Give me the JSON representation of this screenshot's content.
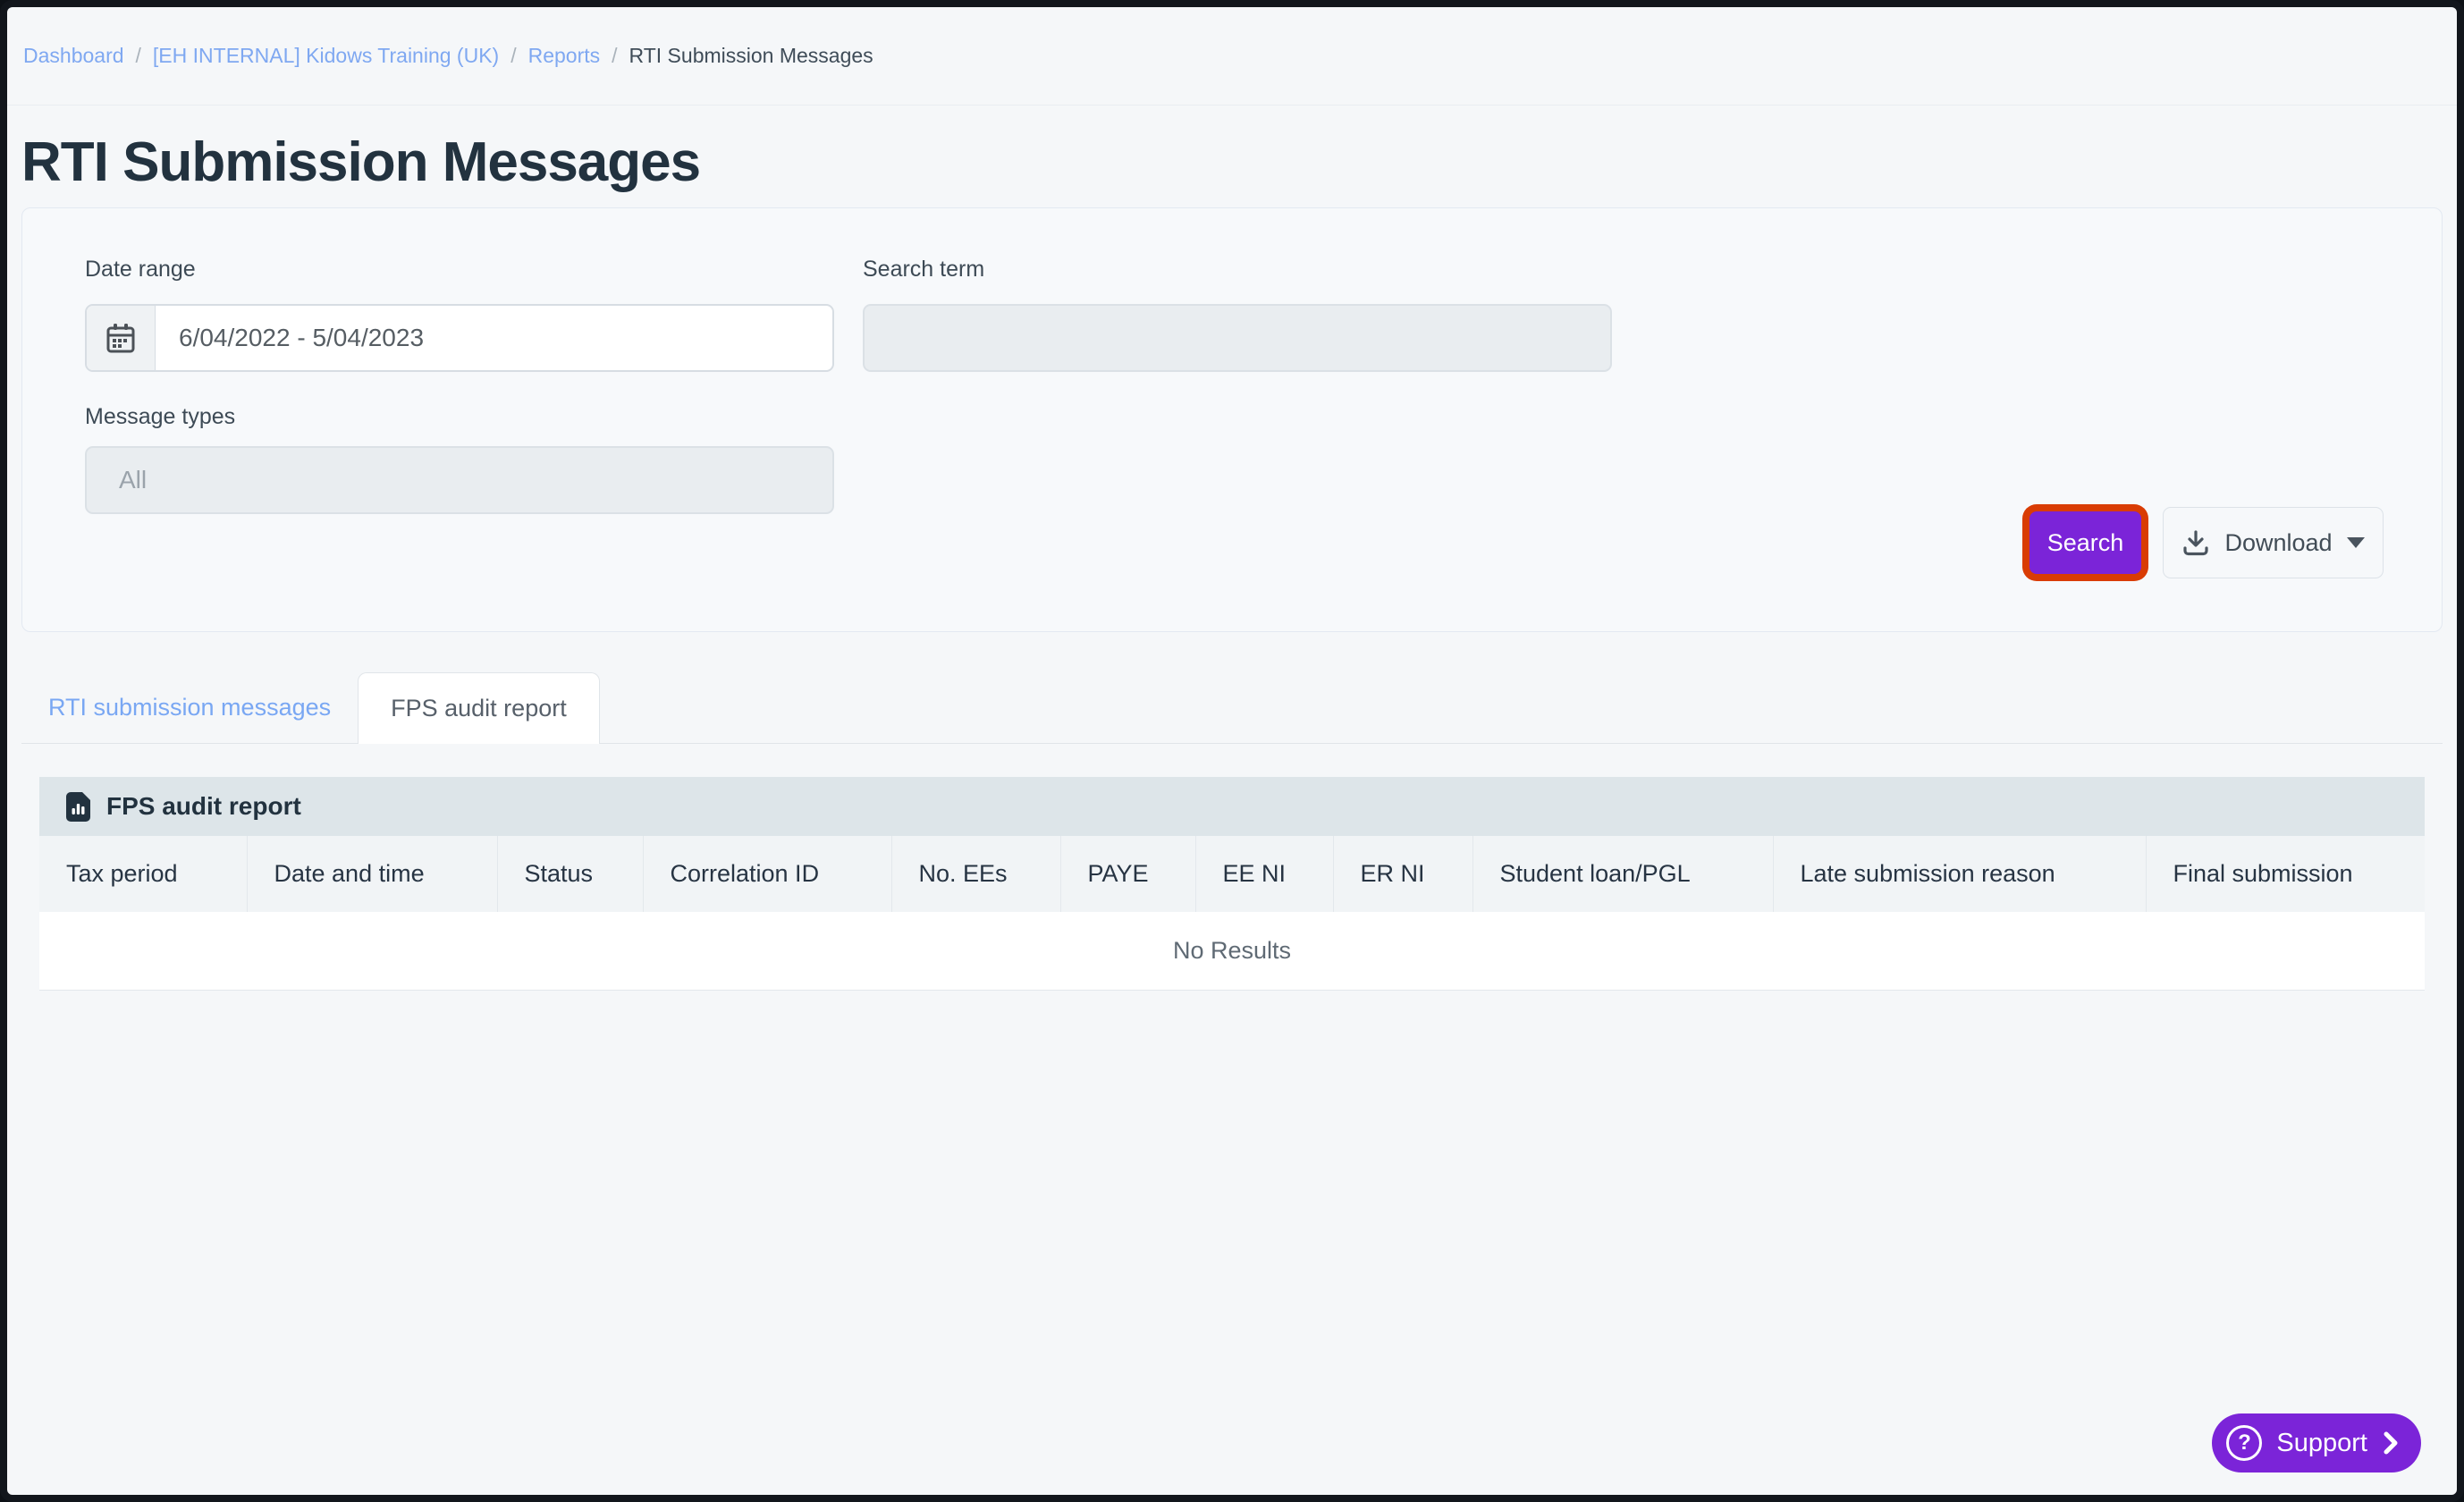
{
  "breadcrumb": {
    "separator": "/",
    "items": [
      {
        "label": "Dashboard"
      },
      {
        "label": "[EH INTERNAL] Kidows Training (UK)"
      },
      {
        "label": "Reports"
      },
      {
        "label": "RTI Submission Messages"
      }
    ]
  },
  "page": {
    "title": "RTI Submission Messages"
  },
  "filters": {
    "date_range": {
      "label": "Date range",
      "value": "6/04/2022 - 5/04/2023",
      "icon": "calendar-icon"
    },
    "search_term": {
      "label": "Search term",
      "value": ""
    },
    "message_types": {
      "label": "Message types",
      "placeholder": "All"
    },
    "search_button": "Search",
    "download_button": "Download"
  },
  "tabs": [
    {
      "label": "RTI submission messages",
      "active": false
    },
    {
      "label": "FPS audit report",
      "active": true
    }
  ],
  "table": {
    "title": "FPS audit report",
    "icon": "report-icon",
    "columns": [
      "Tax period",
      "Date and time",
      "Status",
      "Correlation ID",
      "No. EEs",
      "PAYE",
      "EE NI",
      "ER NI",
      "Student loan/PGL",
      "Late submission reason",
      "Final submission"
    ],
    "rows": [],
    "empty_text": "No Results"
  },
  "support": {
    "label": "Support",
    "icon": "question-circle-icon"
  },
  "colors": {
    "accent_purple": "#7b24d8",
    "focus_ring_orange": "#d93c04",
    "link_blue": "#7fa8f1",
    "heading_navy": "#22323f",
    "card_header_bg": "#dde5e9"
  }
}
